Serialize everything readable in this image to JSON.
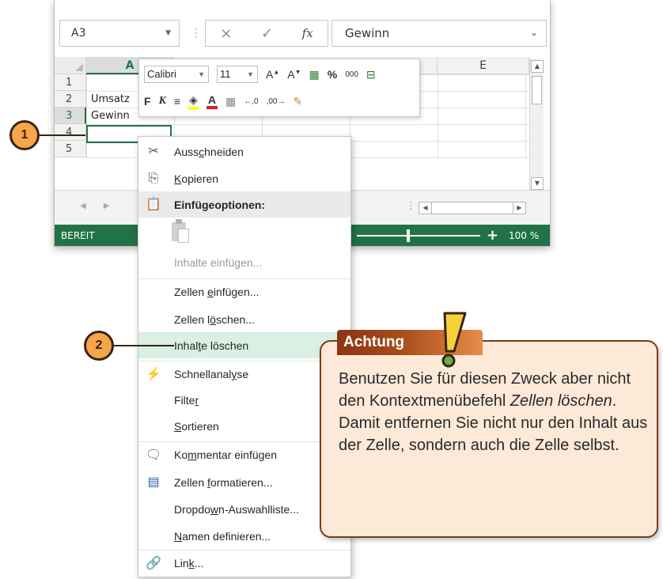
{
  "namebox": {
    "value": "A3"
  },
  "formula_bar": {
    "cancel_icon": "×",
    "enter_icon": "✓",
    "fx_label": "fx",
    "content": "Gewinn"
  },
  "grid": {
    "columns": [
      "A",
      "E"
    ],
    "rows": [
      "1",
      "2",
      "3",
      "4",
      "5"
    ],
    "cells": {
      "a2": "Umsatz",
      "a3": "Gewinn"
    }
  },
  "statusbar": {
    "ready": "BEREIT",
    "zoom": "100 %",
    "plus": "+"
  },
  "minibar": {
    "font": "Calibri",
    "size": "11",
    "bold": "F",
    "italic": "K",
    "percent": "%",
    "thousands": "000"
  },
  "context_menu": {
    "cut": {
      "pre": "Auss",
      "u": "c",
      "post": "hneiden"
    },
    "copy": {
      "pre": "",
      "u": "K",
      "post": "opieren"
    },
    "paste_options": "Einfügeoptionen:",
    "paste_special": {
      "pre": "Inhalte einfü",
      "u": "g",
      "post": "en..."
    },
    "insert_cells": {
      "pre": "Zellen ",
      "u": "e",
      "post": "infügen..."
    },
    "delete_cells": {
      "pre": "Zellen l",
      "u": "ö",
      "post": "schen..."
    },
    "clear_contents": {
      "pre": "Inhal",
      "u": "t",
      "post": "e löschen"
    },
    "quick_analysis": {
      "pre": "Schnellanal",
      "u": "y",
      "post": "se"
    },
    "filter": {
      "pre": "Filte",
      "u": "r",
      "post": ""
    },
    "sort": {
      "pre": "",
      "u": "S",
      "post": "ortieren"
    },
    "insert_comment": {
      "pre": "Ko",
      "u": "m",
      "post": "mentar einfügen"
    },
    "format_cells": {
      "pre": "Zellen ",
      "u": "f",
      "post": "ormatieren..."
    },
    "dropdown": {
      "pre": "Dropdo",
      "u": "w",
      "post": "n-Auswahlliste..."
    },
    "define_name": {
      "pre": "",
      "u": "N",
      "post": "amen definieren..."
    },
    "link": {
      "pre": "Lin",
      "u": "k",
      "post": "..."
    }
  },
  "callouts": {
    "one": "1",
    "two": "2"
  },
  "note": {
    "title": "Achtung",
    "text_before": "Benutzen Sie für diesen Zweck aber nicht den Kontextmenü­befehl ",
    "text_em": "Zellen löschen",
    "text_after": ". Damit ent­fernen Sie nicht nur den Inhalt aus der Zelle, sondern auch die Zelle selbst."
  },
  "colors": {
    "excel_green": "#217346",
    "highlight": "#d9f0e2",
    "note_bg": "#fce9d8",
    "note_border": "#7b3d14",
    "callout": "#f5a54a"
  }
}
